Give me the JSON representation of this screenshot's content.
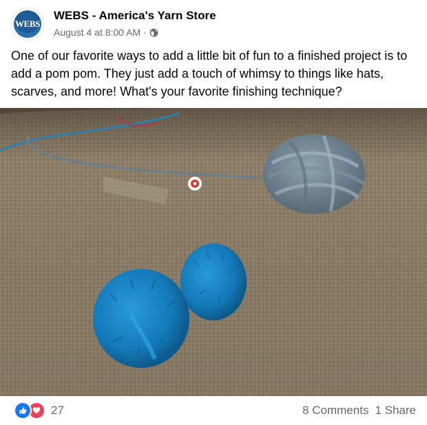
{
  "post": {
    "page_name": "WEBS - America's Yarn Store",
    "avatar_text": "WEBS",
    "date": "August 4 at 8:00 AM",
    "separator": "·",
    "privacy_icon": "globe-icon",
    "text": "One of our favorite ways to add a little bit of fun to a finished project is to add a pom pom. They just add a touch of whimsy to things like hats, scarves, and more! What's your favorite finishing technique?"
  },
  "footer": {
    "reaction_icons": [
      "like-icon",
      "love-icon"
    ],
    "reaction_count": "27",
    "comments": "8 Comments",
    "shares": "1 Share"
  },
  "colors": {
    "like": "#1877f2",
    "love": "#f33e58",
    "secondary_text": "#65676b",
    "pom_pom_blue": "#1a86c9",
    "yarn_gray": "#6f8593",
    "carpet": "#8a7c66"
  }
}
